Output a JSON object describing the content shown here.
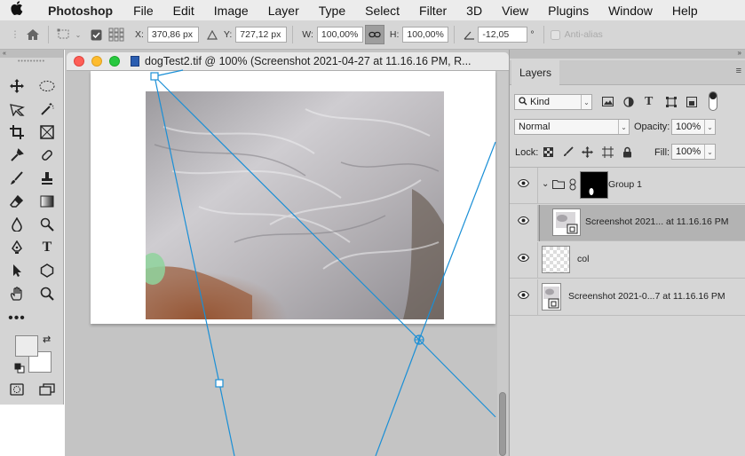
{
  "menubar": {
    "apple": "",
    "app": "Photoshop",
    "items": [
      "File",
      "Edit",
      "Image",
      "Layer",
      "Type",
      "Select",
      "Filter",
      "3D",
      "View",
      "Plugins",
      "Window",
      "Help"
    ]
  },
  "options": {
    "x_label": "X:",
    "x_value": "370,86 px",
    "y_label": "Y:",
    "y_value": "727,12 px",
    "w_label": "W:",
    "w_value": "100,00%",
    "h_label": "H:",
    "h_value": "100,00%",
    "angle_value": "-12,05",
    "angle_unit": "°",
    "antialias_label": "Anti-alias"
  },
  "document": {
    "title": "dogTest2.tif @ 100% (Screenshot 2021-04-27 at 11.16.16 PM, R..."
  },
  "layers_panel": {
    "tab": "Layers",
    "filter_kind": "Kind",
    "blend_mode": "Normal",
    "opacity_label": "Opacity:",
    "opacity_value": "100%",
    "lock_label": "Lock:",
    "fill_label": "Fill:",
    "fill_value": "100%",
    "layers": [
      {
        "name": "Group 1"
      },
      {
        "name": "Screenshot 2021... at 11.16.16 PM"
      },
      {
        "name": "col"
      },
      {
        "name": "Screenshot 2021-0...7 at 11.16.16 PM"
      }
    ]
  },
  "colors": {
    "accent_blue": "#1a8fd6",
    "selected_layer": "#b3b3b3"
  }
}
